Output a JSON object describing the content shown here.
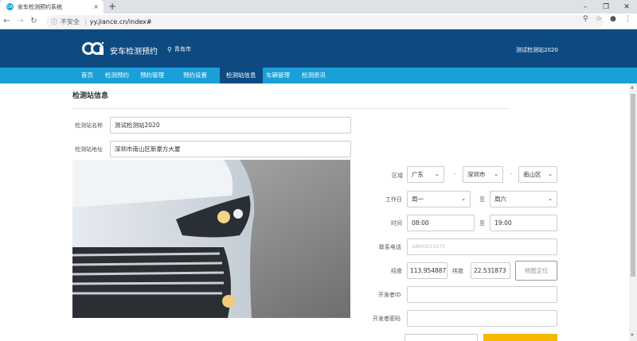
{
  "browser": {
    "tab_title": "安车检测预约系统",
    "favicon_text": "OA",
    "tab_close": "×",
    "new_tab": "+",
    "insecure_label": "不安全",
    "url": "yy.jiance.cn/index#"
  },
  "header": {
    "brand": "安车检测预约",
    "city": "青岛市",
    "station_name": "测试检测站2020"
  },
  "nav": {
    "items": [
      "首页",
      "检测预约",
      "预约管理",
      "预约设置",
      "检测站信息",
      "车辆管理",
      "检测资讯"
    ],
    "active_index": 4
  },
  "page": {
    "title": "检测站信息"
  },
  "form": {
    "name_label": "检测站名称",
    "name_value": "测试检测站2020",
    "address_label": "检测站地址",
    "address_value": "深圳市南山区新豪方大厦",
    "region_label": "区域",
    "province": "广东",
    "city": "深圳市",
    "district": "南山区",
    "dash": "-",
    "workday_label": "工作日",
    "workday_from": "周一",
    "workday_to": "周六",
    "to_label": "至",
    "time_label": "时间",
    "time_from": "08:00",
    "time_to": "19:00",
    "phone_label": "联系电话",
    "phone_value": "18600011073",
    "longitude_label": "经度",
    "longitude_value": "113.954887",
    "latitude_label": "纬度",
    "latitude_value": "22.531873",
    "locate_button": "地图定位",
    "developer_id_label": "开发者ID",
    "developer_id_value": "",
    "developer_pwd_label": "开发者密码",
    "developer_pwd_value": ""
  },
  "colors": {
    "header_bg": "#0d4a82",
    "nav_bg": "#1aa0d8",
    "accent": "#f5b700"
  }
}
